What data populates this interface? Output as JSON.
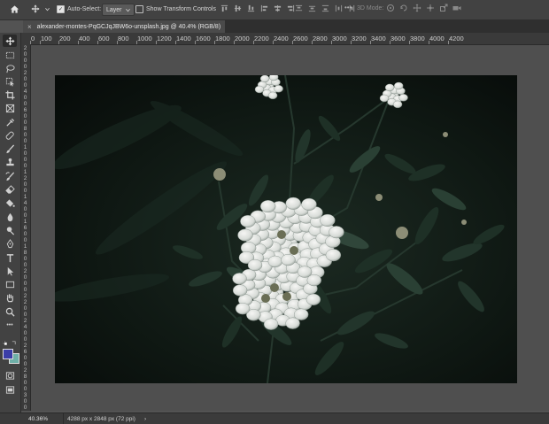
{
  "options_bar": {
    "auto_select_label": "Auto-Select:",
    "auto_select_checked": true,
    "target_value": "Layer",
    "transform_label": "Show Transform Controls",
    "transform_checked": false,
    "mode_3d_label": "3D Mode:"
  },
  "document": {
    "tab_title": "alexander-montes-PqGCJqJBW6o-unsplash.jpg @ 40.4% (RGB/8)",
    "close_glyph": "×"
  },
  "ruler": {
    "h_labels": [
      "0",
      "100",
      "200",
      "400",
      "600",
      "800",
      "1000",
      "1200",
      "1400",
      "1600",
      "1800",
      "2000",
      "2200",
      "2400",
      "2600",
      "2800",
      "3000",
      "3200",
      "3400",
      "3600",
      "3800",
      "4000",
      "4200"
    ],
    "v_labels": [
      "2",
      "0",
      "0",
      "0",
      "2",
      "0",
      "0",
      "4",
      "0",
      "0",
      "6",
      "0",
      "0",
      "8",
      "0",
      "0",
      "1",
      "0",
      "0",
      "0",
      "1",
      "2",
      "0",
      "0",
      "1",
      "4",
      "0",
      "0",
      "1",
      "6",
      "0",
      "0",
      "1",
      "8",
      "0",
      "0",
      "2",
      "0",
      "0",
      "0",
      "2",
      "2",
      "0",
      "0",
      "2",
      "4",
      "0",
      "0",
      "2",
      "6",
      "0",
      "0",
      "2",
      "8",
      "0",
      "0",
      "3",
      "0",
      "0"
    ]
  },
  "colors": {
    "foreground": "#3b3ea8",
    "background": "#6fb0a8"
  },
  "status": {
    "zoom": "40.36%",
    "doc_info": "4288 px x 2848 px (72 ppi)",
    "arrow": "›"
  }
}
